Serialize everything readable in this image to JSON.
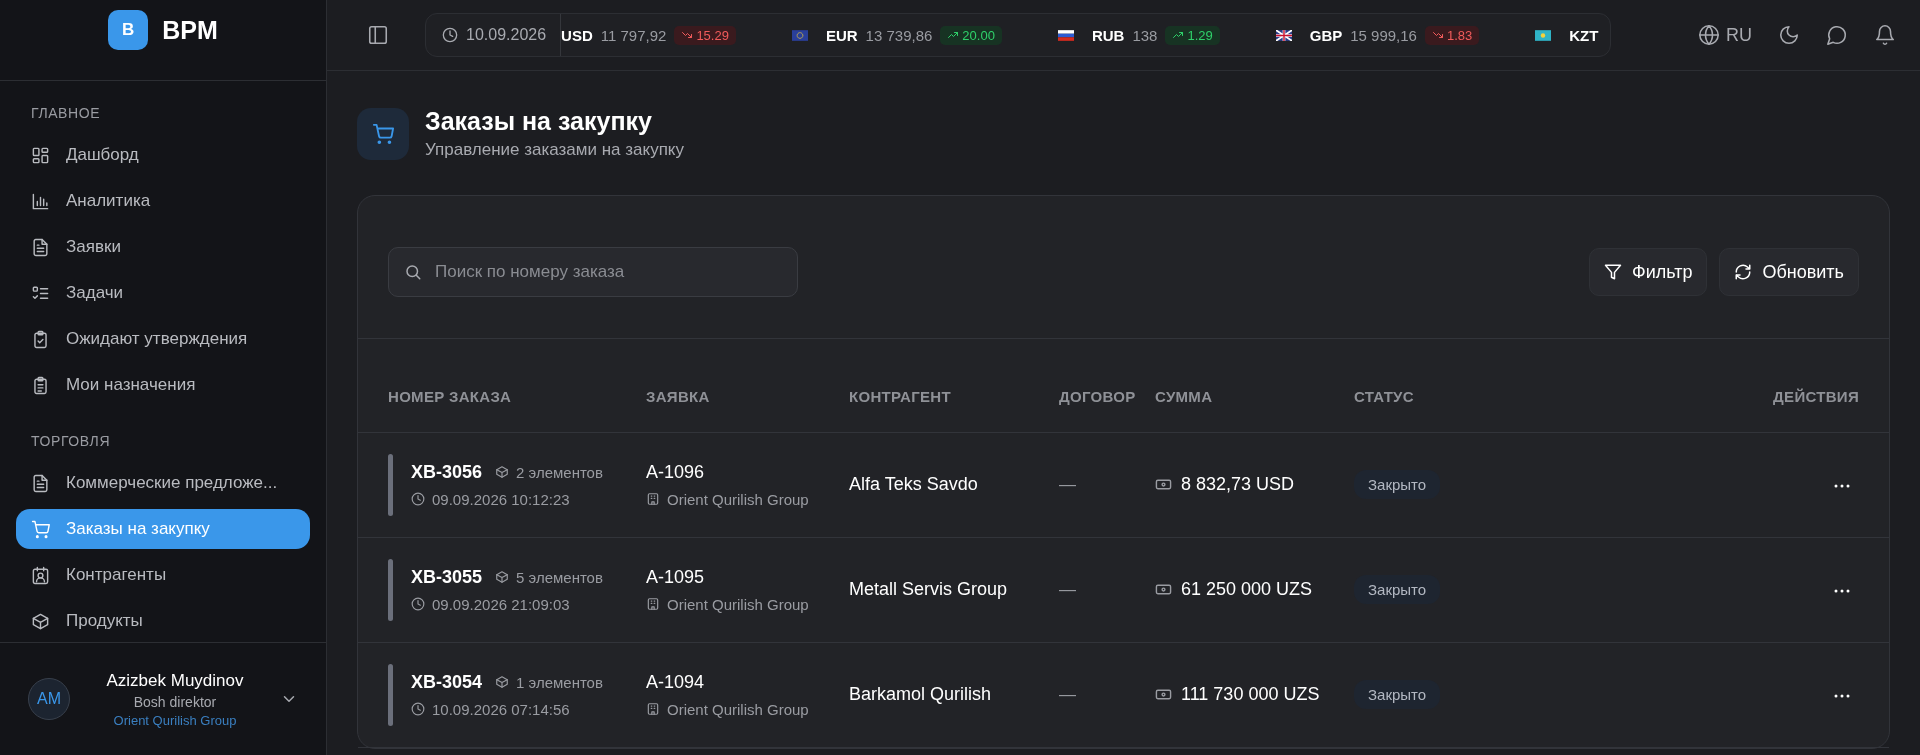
{
  "brand": {
    "logo_letter": "B",
    "name": "BPM"
  },
  "ticker": {
    "date": "10.09.2026",
    "items": [
      {
        "code": "USD",
        "value": "11 797,92",
        "change": "15.29",
        "kind": "down"
      },
      {
        "code": "EUR",
        "value": "13 739,86",
        "change": "20.00",
        "kind": "up"
      },
      {
        "code": "RUB",
        "value": "138",
        "change": "1.29",
        "kind": "up"
      },
      {
        "code": "GBP",
        "value": "15 999,16",
        "change": "1.83",
        "kind": "down"
      },
      {
        "code": "KZT"
      }
    ]
  },
  "topbar": {
    "language": "RU"
  },
  "sidebar": {
    "sections": [
      {
        "title": "ГЛАВНОЕ",
        "items": [
          {
            "label": "Дашборд",
            "selected": false
          },
          {
            "label": "Аналитика",
            "selected": false
          },
          {
            "label": "Заявки",
            "selected": false
          },
          {
            "label": "Задачи",
            "selected": false
          },
          {
            "label": "Ожидают утверждения",
            "selected": false
          },
          {
            "label": "Мои назначения",
            "selected": false
          }
        ]
      },
      {
        "title": "ТОРГОВЛЯ",
        "items": [
          {
            "label": "Коммерческие предложе...",
            "selected": false
          },
          {
            "label": "Заказы на закупку",
            "selected": true
          },
          {
            "label": "Контрагенты",
            "selected": false
          },
          {
            "label": "Продукты",
            "selected": false
          }
        ]
      }
    ],
    "user": {
      "initials": "AM",
      "name": "Azizbek Muydinov",
      "role": "Bosh direktor",
      "company": "Orient Qurilish Group"
    }
  },
  "page": {
    "title": "Заказы на закупку",
    "subtitle": "Управление заказами на закупку"
  },
  "toolbar": {
    "search": {
      "placeholder": "Поиск по номеру заказа"
    },
    "buttons": [
      "Фильтр",
      "Обновить"
    ]
  },
  "table": {
    "columns": [
      "НОМЕР ЗАКАЗА",
      "ЗАЯВКА",
      "КОНТРАГЕНТ",
      "ДОГОВОР",
      "СУММА",
      "СТАТУС",
      "ДЕЙСТВИЯ"
    ],
    "rows": [
      {
        "number": "XB-3056",
        "items": "2 элементов",
        "datetime": "09.09.2026 10:12:23",
        "request": "A-1096",
        "company": "Orient Qurilish Group",
        "counterparty": "Alfa Teks Savdo",
        "contract": "—",
        "amount": "8 832,73 USD",
        "status": "Закрыто"
      },
      {
        "number": "XB-3055",
        "items": "5 элементов",
        "datetime": "09.09.2026 21:09:03",
        "request": "A-1095",
        "company": "Orient Qurilish Group",
        "counterparty": "Metall Servis Group",
        "contract": "—",
        "amount": "61 250 000 UZS",
        "status": "Закрыто"
      },
      {
        "number": "XB-3054",
        "items": "1 элементов",
        "datetime": "10.09.2026 07:14:56",
        "request": "A-1094",
        "company": "Orient Qurilish Group",
        "counterparty": "Barkamol Qurilish",
        "contract": "—",
        "amount": "111 730 000 UZS",
        "status": "Закрыто"
      }
    ]
  }
}
